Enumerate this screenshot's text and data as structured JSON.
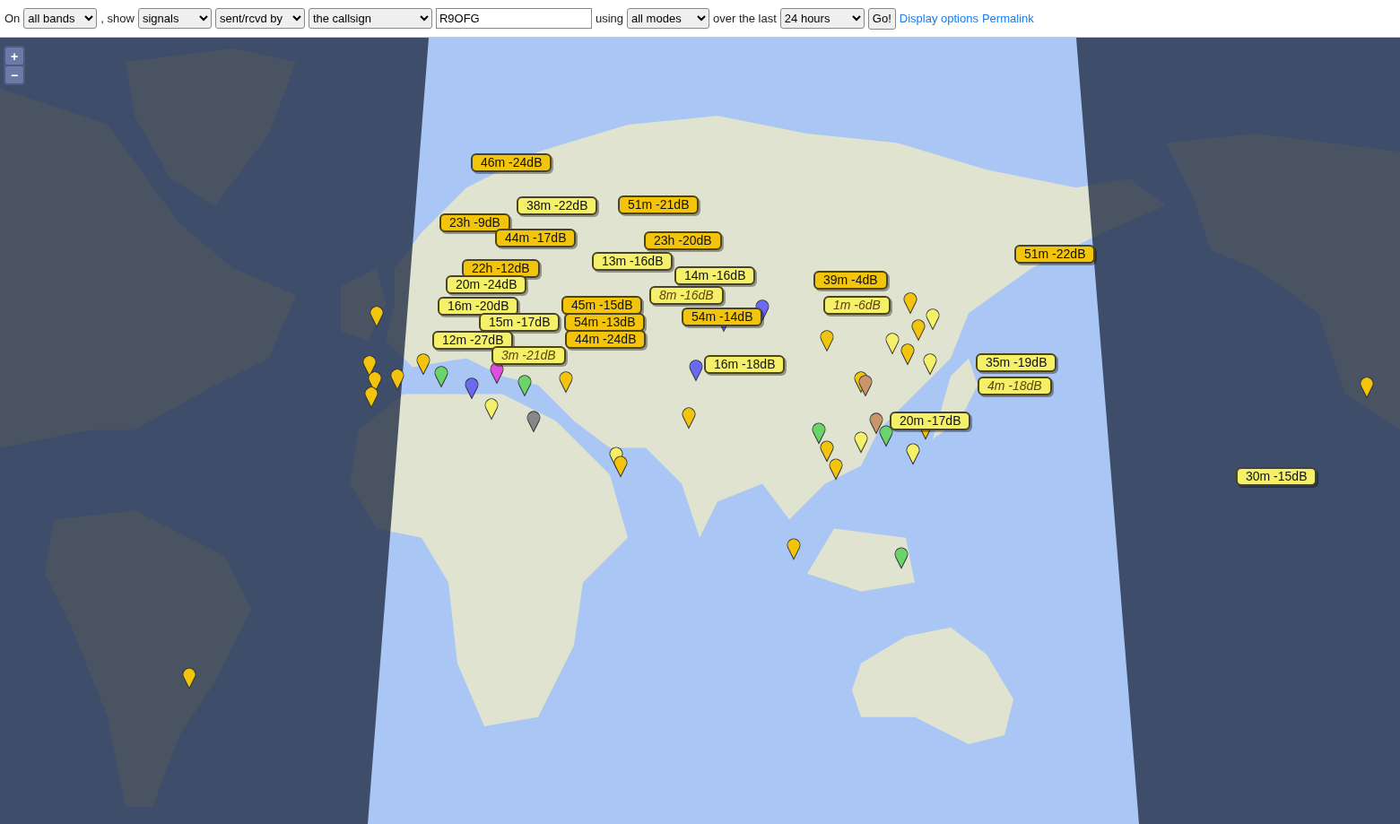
{
  "toolbar": {
    "items": [
      {
        "kind": "text",
        "text": "On"
      },
      {
        "kind": "select",
        "value": "all bands"
      },
      {
        "kind": "text",
        "text": ", show"
      },
      {
        "kind": "select",
        "value": "signals"
      },
      {
        "kind": "select",
        "value": "sent/rcvd by"
      },
      {
        "kind": "select",
        "value": "the callsign"
      },
      {
        "kind": "input",
        "value": "R9OFG"
      },
      {
        "kind": "text",
        "text": "using"
      },
      {
        "kind": "select",
        "value": "all modes"
      },
      {
        "kind": "text",
        "text": "over the last"
      },
      {
        "kind": "select",
        "value": "24 hours"
      },
      {
        "kind": "button",
        "text": "Go!"
      },
      {
        "kind": "link",
        "text": "Display options"
      },
      {
        "kind": "link",
        "text": "Permalink"
      }
    ]
  },
  "map": {
    "zoom_in": "+",
    "zoom_out": "−",
    "reports": [
      {
        "text": "46m -24dB",
        "color": "#f2c40c",
        "highlighted": false
      },
      {
        "text": "38m -22dB",
        "color": "#f5f06a",
        "highlighted": false
      },
      {
        "text": "51m -21dB",
        "color": "#f2c40c",
        "highlighted": false
      },
      {
        "text": "23h -9dB",
        "color": "#f2c40c",
        "highlighted": false
      },
      {
        "text": "44m -17dB",
        "color": "#f2c40c",
        "highlighted": false
      },
      {
        "text": "23h -20dB",
        "color": "#f2c40c",
        "highlighted": false
      },
      {
        "text": "13m -16dB",
        "color": "#f5f06a",
        "highlighted": false
      },
      {
        "text": "22h -12dB",
        "color": "#f2c40c",
        "highlighted": false
      },
      {
        "text": "14m -16dB",
        "color": "#f5f06a",
        "highlighted": false
      },
      {
        "text": "20m -24dB",
        "color": "#f5f06a",
        "highlighted": false
      },
      {
        "text": "8m -16dB",
        "color": "#f5f06a",
        "highlighted": true
      },
      {
        "text": "16m -20dB",
        "color": "#f5f06a",
        "highlighted": false
      },
      {
        "text": "45m -15dB",
        "color": "#f2c40c",
        "highlighted": false
      },
      {
        "text": "54m -14dB",
        "color": "#f2c40c",
        "highlighted": false
      },
      {
        "text": "15m -17dB",
        "color": "#f5f06a",
        "highlighted": false
      },
      {
        "text": "54m -13dB",
        "color": "#f2c40c",
        "highlighted": false
      },
      {
        "text": "12m -27dB",
        "color": "#f5f06a",
        "highlighted": false
      },
      {
        "text": "44m -24dB",
        "color": "#f2c40c",
        "highlighted": false
      },
      {
        "text": "3m -21dB",
        "color": "#f5f06a",
        "highlighted": true
      },
      {
        "text": "39m -4dB",
        "color": "#f2c40c",
        "highlighted": false
      },
      {
        "text": "1m -6dB",
        "color": "#f5f06a",
        "highlighted": true
      },
      {
        "text": "51m -22dB",
        "color": "#f2c40c",
        "highlighted": false
      },
      {
        "text": "16m -18dB",
        "color": "#f5f06a",
        "highlighted": false
      },
      {
        "text": "35m -19dB",
        "color": "#f5f06a",
        "highlighted": false
      },
      {
        "text": "4m -18dB",
        "color": "#f5f06a",
        "highlighted": true
      },
      {
        "text": "20m -17dB",
        "color": "#f5f06a",
        "highlighted": false
      },
      {
        "text": "30m -15dB",
        "color": "#f5f06a",
        "highlighted": false
      }
    ]
  }
}
